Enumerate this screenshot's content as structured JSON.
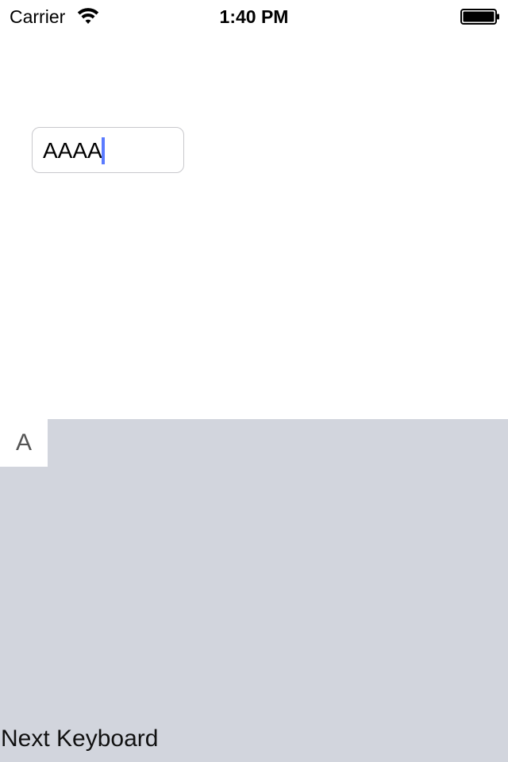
{
  "status_bar": {
    "carrier": "Carrier",
    "wifi_icon": "wifi-icon",
    "time": "1:40 PM",
    "battery_icon": "battery-icon"
  },
  "text_field": {
    "value": "AAAA",
    "cursor_color": "#5b7bff"
  },
  "keyboard": {
    "background_color": "#d2d5dd",
    "key_a_label": "A",
    "next_keyboard_label": "Next Keyboard"
  }
}
